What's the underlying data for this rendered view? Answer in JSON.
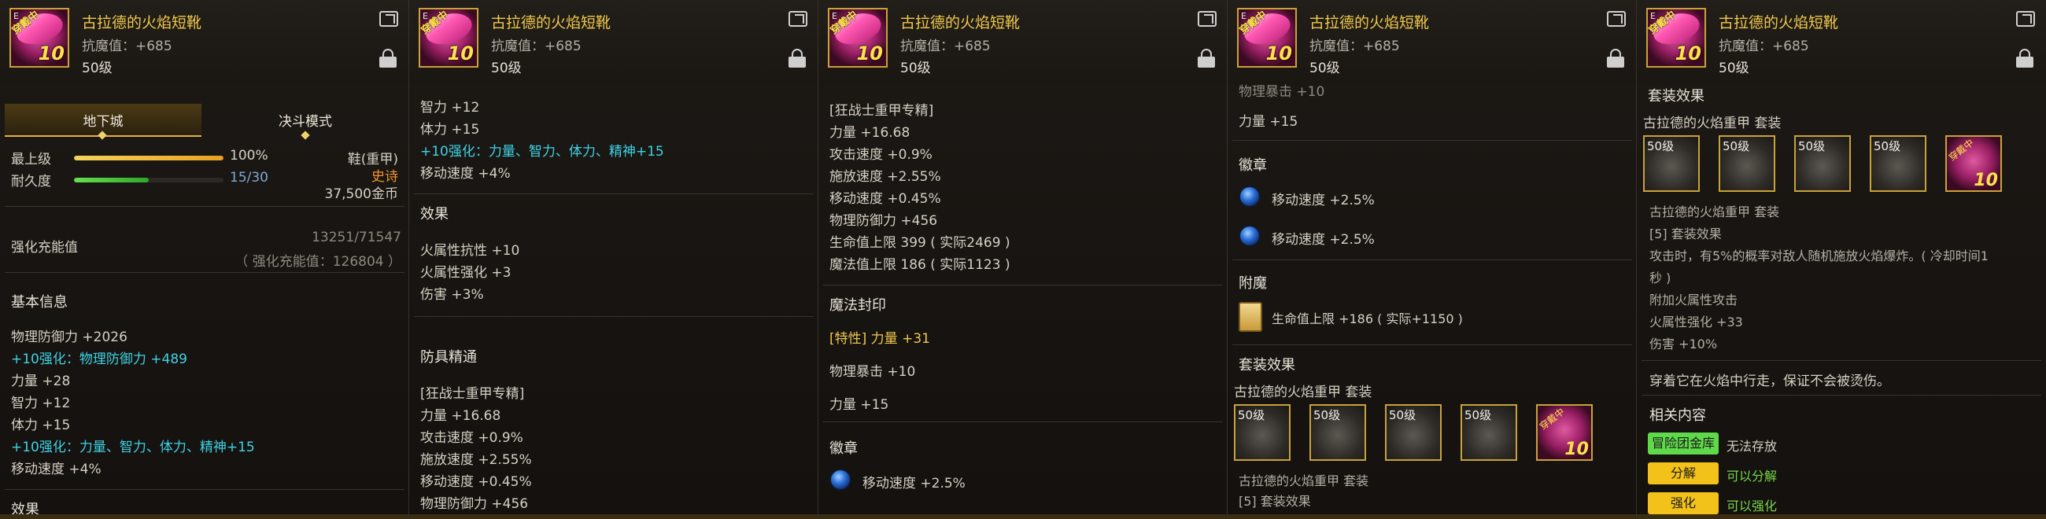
{
  "item": {
    "name": "古拉德的火焰短靴",
    "anti_magic": "抗魔值：+685",
    "level": "50级",
    "icon_label_top": "穿戴中",
    "icon_label_plus": "10",
    "icon_corner": "E"
  },
  "panel1": {
    "tabs": [
      "地下城",
      "决斗模式"
    ],
    "upgrade_label": "最上级",
    "upgrade_value": "100%",
    "durability_label": "耐久度",
    "durability_value": "15/30",
    "durability_fraction": 0.5,
    "upgrade_fraction": 1.0,
    "type": "鞋(重甲)",
    "rarity": "史诗",
    "price": "37,500金币",
    "enhance_label": "强化充能值",
    "enhance_value": "13251/71547",
    "enhance_sub": "（ 强化充能值：126804 ）",
    "basic_title": "基本信息",
    "basic_lines": [
      "物理防御力 +2026",
      "+10强化：物理防御力 +489",
      "力量 +28",
      "智力 +12",
      "体力 +15",
      "+10强化：力量、智力、体力、精神+15",
      "移动速度 +4%"
    ],
    "cut_title": "效果"
  },
  "panel2": {
    "lines_top": [
      "智力 +12",
      "体力 +15",
      "+10强化：力量、智力、体力、精神+15",
      "移动速度 +4%"
    ],
    "effect_title": "效果",
    "effect_lines": [
      "火属性抗性 +10",
      "火属性强化 +3",
      "伤害 +3%"
    ],
    "mastery_title": "防具精通",
    "mastery_lines": [
      "[狂战士重甲专精]",
      "力量 +16.68",
      "攻击速度 +0.9%",
      "施放速度 +2.55%",
      "移动速度 +0.45%",
      "物理防御力 +456"
    ]
  },
  "panel3": {
    "lines": [
      "[狂战士重甲专精]",
      "力量 +16.68",
      "攻击速度 +0.9%",
      "施放速度 +2.55%",
      "移动速度 +0.45%",
      "物理防御力 +456",
      "生命值上限 399 ( 实际2469 )",
      "魔法值上限 186 ( 实际1123 )"
    ],
    "seal_title": "魔法封印",
    "seal_lines": [
      "[特性] 力量 +31",
      "物理暴击 +10",
      "力量 +15"
    ],
    "emblem_title": "徽章",
    "emblem_line": "移动速度 +2.5%"
  },
  "panel4": {
    "top_lines": [
      "物理暴击 +10",
      "力量 +15"
    ],
    "emblem_title": "徽章",
    "emblem_lines": [
      "移动速度 +2.5%",
      "移动速度 +2.5%"
    ],
    "enchant_title": "附魔",
    "enchant_line": "生命值上限 +186 ( 实际+1150 )",
    "set_title": "套装效果",
    "set_name": "古拉德的火焰重甲  套装",
    "slot_levels": [
      "50级",
      "50级",
      "50级",
      "50级"
    ],
    "set_footer": "古拉德的火焰重甲  套装",
    "set_footer2": "[5] 套装效果"
  },
  "panel5": {
    "set_title": "套装效果",
    "set_name": "古拉德的火焰重甲  套装",
    "slot_levels": [
      "50级",
      "50级",
      "50级",
      "50级"
    ],
    "set_sub": "古拉德的火焰重甲  套装",
    "set_count": "[5] 套装效果",
    "desc1": "攻击时，有5%的概率对敌人随机施放火焰爆炸。( 冷却时间1",
    "desc2": "秒 )",
    "lines": [
      "附加火属性攻击",
      "火属性强化 +33",
      "伤害 +10%"
    ],
    "quote": "穿着它在火焰中行走，保证不会被烫伤。",
    "related_title": "相关内容",
    "badge1": "冒险团金库",
    "badge1_text": "无法存放",
    "badge2": "分解",
    "badge2_text": "可以分解",
    "badge3": "强化",
    "badge3_text": "可以强化"
  }
}
